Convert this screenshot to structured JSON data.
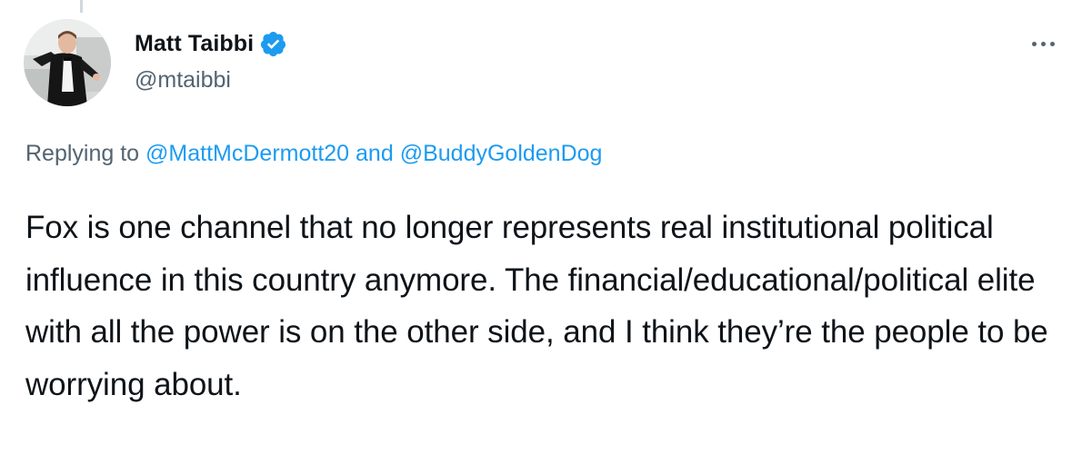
{
  "tweet": {
    "author": {
      "display_name": "Matt Taibbi",
      "handle": "@mtaibbi",
      "verified": true,
      "verified_icon": "verified-badge-icon",
      "verified_color": "#1d9bf0"
    },
    "more_icon": "more-options-icon",
    "reply_context": {
      "prefix": "Replying to",
      "mention_1": "@MattMcDermott20",
      "joiner": "and",
      "mention_2": "@BuddyGoldenDog"
    },
    "text": "Fox is one channel that no longer represents real institutional political influence in this country anymore. The financial/educational/political elite with all the power is on the other side, and I think they’re the people to be worrying about."
  },
  "colors": {
    "text_primary": "#0f1419",
    "text_secondary": "#536471",
    "link": "#1d9bf0"
  }
}
